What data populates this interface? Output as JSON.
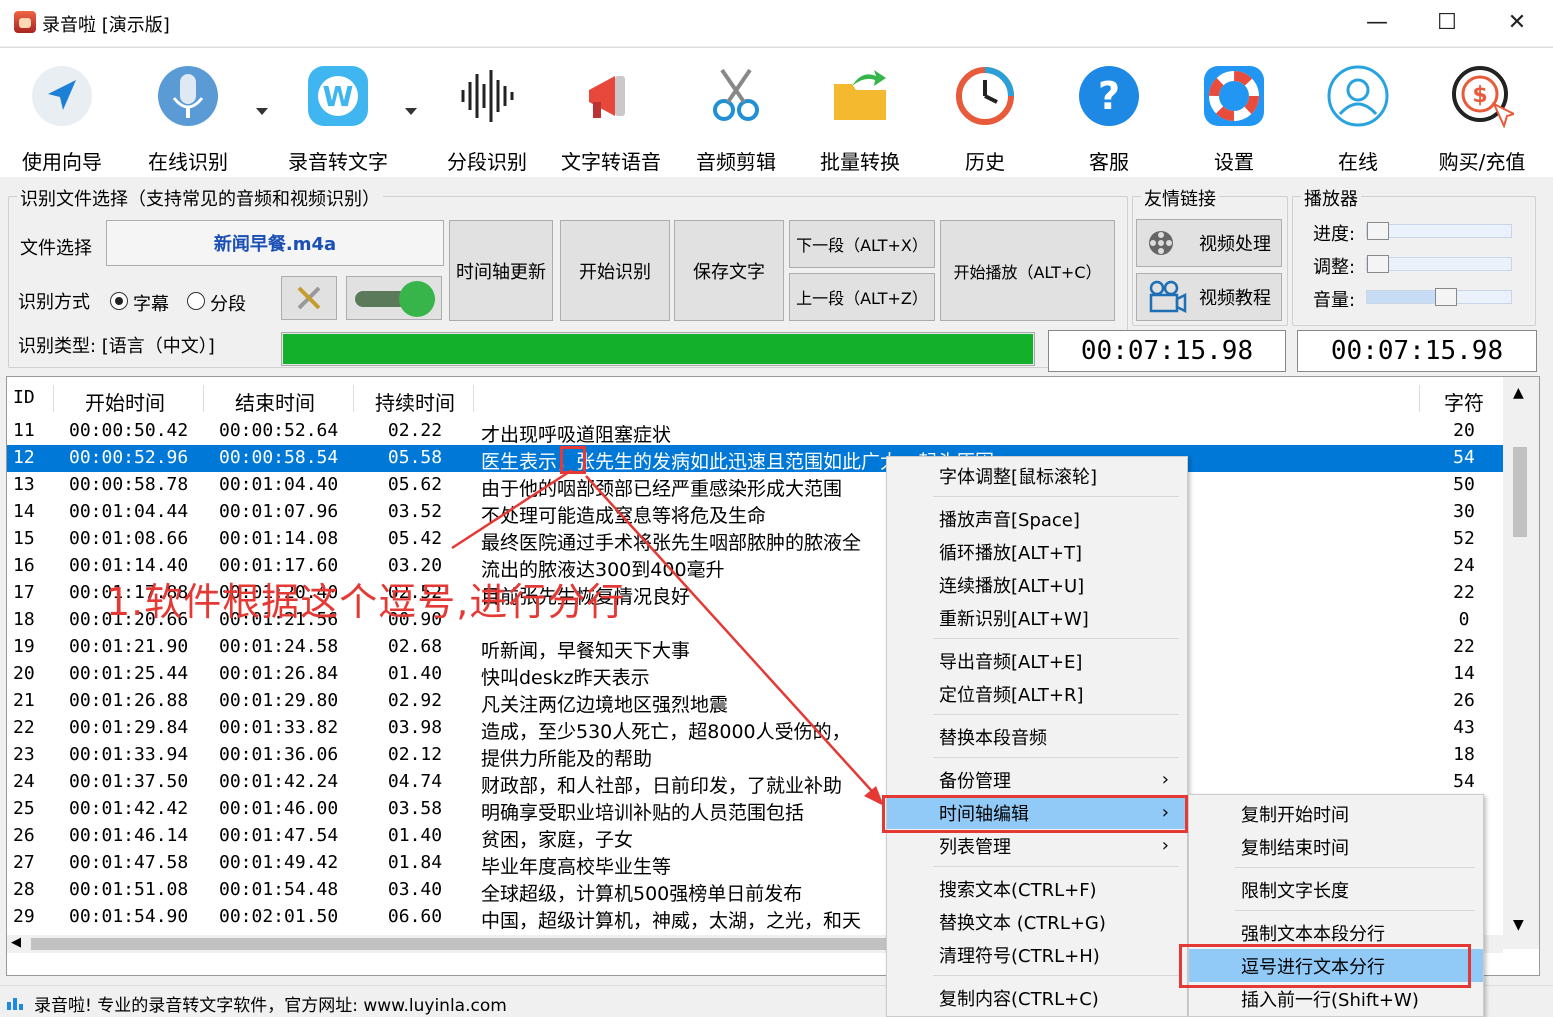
{
  "window": {
    "title": "录音啦 [演示版]",
    "min": "—",
    "max": "☐",
    "close": "✕"
  },
  "toolbar": [
    {
      "label": "使用向导",
      "icon": "navigation-arrow-icon"
    },
    {
      "label": "在线识别",
      "icon": "microphone-icon"
    },
    {
      "label": "录音转文字",
      "icon": "w-logo-icon"
    },
    {
      "label": "分段识别",
      "icon": "waveform-icon"
    },
    {
      "label": "文字转语音",
      "icon": "megaphone-icon"
    },
    {
      "label": "音频剪辑",
      "icon": "scissors-icon"
    },
    {
      "label": "批量转换",
      "icon": "folder-arrow-icon"
    },
    {
      "label": "历史",
      "icon": "history-clock-icon"
    },
    {
      "label": "客服",
      "icon": "help-question-icon"
    },
    {
      "label": "设置",
      "icon": "lifebuoy-icon"
    },
    {
      "label": "在线",
      "icon": "user-icon"
    },
    {
      "label": "购买/充值",
      "icon": "purchase-coin-icon"
    }
  ],
  "recog_group": {
    "title": "识别文件选择（支持常见的音频和视频识别）",
    "file_label": "文件选择",
    "file_name": "新闻早餐.m4a",
    "mode_label": "识别方式",
    "mode_subtitle": "字幕",
    "mode_segment": "分段",
    "type_label": "识别类型: [语言（中文）]",
    "btn_timeline": "时间轴更新",
    "btn_start": "开始识别",
    "btn_save": "保存文字",
    "btn_next": "下一段（ALT+X）",
    "btn_prev": "上一段（ALT+Z）",
    "btn_play": "开始播放（ALT+C）",
    "progress": 1.0,
    "progress_color": "#13b02c",
    "time1": "00:07:15.98",
    "time2": "00:07:15.98"
  },
  "links_group": {
    "title": "友情链接",
    "video_proc": "视频处理",
    "video_tut": "视频教程"
  },
  "player_group": {
    "title": "播放器",
    "progress_label": "进度:",
    "adjust_label": "调整:",
    "volume_label": "音量:",
    "volume": 0.55
  },
  "table": {
    "headers": {
      "id": "ID",
      "start": "开始时间",
      "end": "结束时间",
      "dur": "持续时间",
      "text": "",
      "chars": "字符"
    },
    "rows": [
      {
        "id": "11",
        "start": "00:00:50.42",
        "end": "00:00:52.64",
        "dur": "02.22",
        "text": "才出现呼吸道阻塞症状",
        "chars": "20"
      },
      {
        "id": "12",
        "start": "00:00:52.96",
        "end": "00:00:58.54",
        "dur": "05.58",
        "text": "医生表示，张先生的发病如此迅速且范围如此广大，起头原因",
        "chars": "54",
        "selected": true
      },
      {
        "id": "13",
        "start": "00:00:58.78",
        "end": "00:01:04.40",
        "dur": "05.62",
        "text": "由于他的咽部颈部已经严重感染形成大范围",
        "chars": "50"
      },
      {
        "id": "14",
        "start": "00:01:04.44",
        "end": "00:01:07.96",
        "dur": "03.52",
        "text": "不处理可能造成窒息等将危及生命",
        "chars": "30"
      },
      {
        "id": "15",
        "start": "00:01:08.66",
        "end": "00:01:14.08",
        "dur": "05.42",
        "text": "最终医院通过手术将张先生咽部脓肿的脓液全",
        "chars": "52"
      },
      {
        "id": "16",
        "start": "00:01:14.40",
        "end": "00:01:17.60",
        "dur": "03.20",
        "text": "流出的脓液达300到400毫升",
        "chars": "24"
      },
      {
        "id": "17",
        "start": "00:01:17.88",
        "end": "00:01:20.40",
        "dur": "02.52",
        "text": "目前张先生恢复情况良好",
        "chars": "22"
      },
      {
        "id": "18",
        "start": "00:01:20.66",
        "end": "00:01:21.56",
        "dur": "00.90",
        "text": "",
        "chars": "0"
      },
      {
        "id": "19",
        "start": "00:01:21.90",
        "end": "00:01:24.58",
        "dur": "02.68",
        "text": "听新闻，早餐知天下大事",
        "chars": "22"
      },
      {
        "id": "20",
        "start": "00:01:25.44",
        "end": "00:01:26.84",
        "dur": "01.40",
        "text": "快叫deskz昨天表示",
        "chars": "14"
      },
      {
        "id": "21",
        "start": "00:01:26.88",
        "end": "00:01:29.80",
        "dur": "02.92",
        "text": "凡关注两亿边境地区强烈地震",
        "chars": "26"
      },
      {
        "id": "22",
        "start": "00:01:29.84",
        "end": "00:01:33.82",
        "dur": "03.98",
        "text": "造成，至少530人死亡，超8000人受伤的，",
        "chars": "43"
      },
      {
        "id": "23",
        "start": "00:01:33.94",
        "end": "00:01:36.06",
        "dur": "02.12",
        "text": "提供力所能及的帮助",
        "chars": "18"
      },
      {
        "id": "24",
        "start": "00:01:37.50",
        "end": "00:01:42.24",
        "dur": "04.74",
        "text": "财政部，和人社部，日前印发，了就业补助",
        "chars": "54"
      },
      {
        "id": "25",
        "start": "00:01:42.42",
        "end": "00:01:46.00",
        "dur": "03.58",
        "text": "明确享受职业培训补贴的人员范围包括",
        "chars": ""
      },
      {
        "id": "26",
        "start": "00:01:46.14",
        "end": "00:01:47.54",
        "dur": "01.40",
        "text": "贫困，家庭，子女",
        "chars": ""
      },
      {
        "id": "27",
        "start": "00:01:47.58",
        "end": "00:01:49.42",
        "dur": "01.84",
        "text": "毕业年度高校毕业生等",
        "chars": ""
      },
      {
        "id": "28",
        "start": "00:01:51.08",
        "end": "00:01:54.48",
        "dur": "03.40",
        "text": "全球超级，计算机500强榜单日前发布",
        "chars": ""
      },
      {
        "id": "29",
        "start": "00:01:54.90",
        "end": "00:02:01.50",
        "dur": "06.60",
        "text": "中国，超级计算机，神威，太湖，之光，和天",
        "chars": ""
      }
    ]
  },
  "context_menu": [
    {
      "label": "字体调整[鼠标滚轮]"
    },
    {
      "sep": true
    },
    {
      "label": "播放声音[Space]"
    },
    {
      "label": "循环播放[ALT+T]"
    },
    {
      "label": "连续播放[ALT+U]"
    },
    {
      "label": "重新识别[ALT+W]"
    },
    {
      "sep": true
    },
    {
      "label": "导出音频[ALT+E]"
    },
    {
      "label": "定位音频[ALT+R]"
    },
    {
      "sep": true
    },
    {
      "label": "替换本段音频"
    },
    {
      "sep": true
    },
    {
      "label": "备份管理",
      "sub": true
    },
    {
      "label": "时间轴编辑",
      "sub": true,
      "hl": true
    },
    {
      "label": "列表管理",
      "sub": true
    },
    {
      "sep": true
    },
    {
      "label": "搜索文本(CTRL+F)"
    },
    {
      "label": "替换文本 (CTRL+G)"
    },
    {
      "label": "清理符号(CTRL+H)"
    },
    {
      "sep": true
    },
    {
      "label": "复制内容(CTRL+C)"
    }
  ],
  "submenu": [
    {
      "label": "复制开始时间"
    },
    {
      "label": "复制结束时间"
    },
    {
      "sep": true
    },
    {
      "label": "限制文字长度"
    },
    {
      "sep": true
    },
    {
      "label": "强制文本本段分行"
    },
    {
      "label": "逗号进行文本分行",
      "hl": true
    },
    {
      "label": "插入前一行(Shift+W)"
    }
  ],
  "annotation": {
    "text": "1.软件根据这个逗号,进行分行",
    "color": "#e53935"
  },
  "status": {
    "text": "录音啦! 专业的录音转文字软件，官方网址: www.luyinla.com"
  }
}
